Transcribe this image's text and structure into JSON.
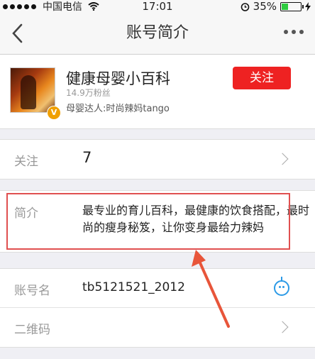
{
  "status_bar": {
    "carrier": "中国电信",
    "time": "17:01",
    "battery": "35%",
    "battery_level": 0.35
  },
  "nav": {
    "title": "账号简介",
    "back_icon": "chevron-left-icon",
    "more_icon": "more-dots-icon"
  },
  "profile": {
    "name": "健康母婴小百科",
    "fans": "14.9万粉丝",
    "description": "母婴达人:时尚辣妈tango",
    "verified_badge": "V",
    "follow_label": "关注",
    "follow_color": "#ee2222"
  },
  "rows": {
    "follow": {
      "label": "关注",
      "value": "7"
    },
    "intro": {
      "label": "简介",
      "value": "最专业的育儿百科，最健康的饮食搭配，最时尚的瘦身秘笈，让你变身最给力辣妈"
    },
    "account": {
      "label": "账号名",
      "value": "tb5121521_2012",
      "icon": "copy-face-icon",
      "icon_color": "#2c9ae6"
    },
    "qrcode": {
      "label": "二维码"
    }
  },
  "annotation": {
    "highlight_color": "#e05050"
  }
}
